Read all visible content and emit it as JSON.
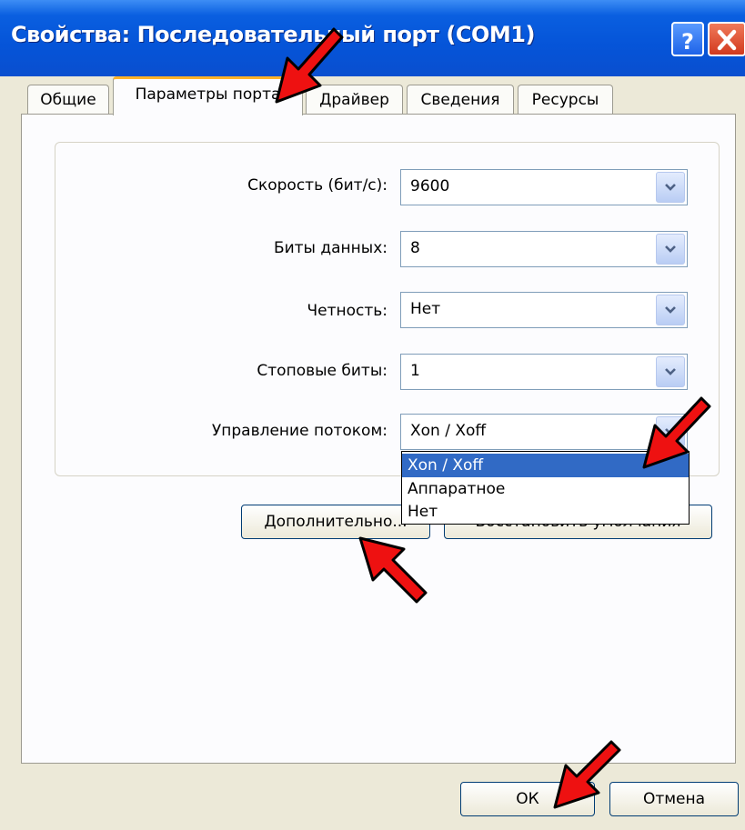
{
  "window": {
    "title": "Свойства: Последовательный порт (COM1)",
    "help_label": "?",
    "close_label": "X"
  },
  "tabs": [
    {
      "label": "Общие",
      "active": false
    },
    {
      "label": "Параметры порта",
      "active": true
    },
    {
      "label": "Драйвер",
      "active": false
    },
    {
      "label": "Сведения",
      "active": false
    },
    {
      "label": "Ресурсы",
      "active": false
    }
  ],
  "settings": {
    "speed": {
      "label": "Скорость (бит/с):",
      "value": "9600"
    },
    "data_bits": {
      "label": "Биты данных:",
      "value": "8"
    },
    "parity": {
      "label": "Четность:",
      "value": "Нет"
    },
    "stop_bits": {
      "label": "Стоповые биты:",
      "value": "1"
    },
    "flow_control": {
      "label": "Управление потоком:",
      "value": "Xon / Xoff"
    }
  },
  "flow_dropdown": {
    "options": [
      "Xon / Xoff",
      "Аппаратное",
      "Нет"
    ],
    "selected_index": 0
  },
  "buttons": {
    "advanced": "Дополнительно...",
    "restore_defaults": "Восстановить умолчания",
    "ok": "ОК",
    "cancel": "Отмена"
  },
  "annotations": {
    "arrow_color": "#ee1111",
    "arrow_count": 4
  }
}
